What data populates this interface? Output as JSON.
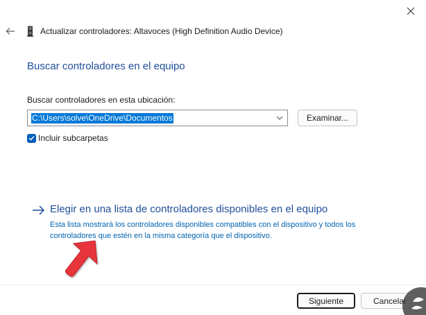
{
  "window": {
    "title": "Actualizar controladores: Altavoces (High Definition Audio Device)"
  },
  "page": {
    "heading": "Buscar controladores en el equipo",
    "location_label": "Buscar controladores en esta ubicación:",
    "path_value": "C:\\Users\\solve\\OneDrive\\Documentos",
    "browse_label": "Examinar...",
    "include_subfolders_label": "Incluir subcarpetas",
    "include_subfolders_checked": true
  },
  "pick_option": {
    "title": "Elegir en una lista de controladores disponibles en el equipo",
    "description": "Esta lista mostrará los controladores disponibles compatibles con el dispositivo y todos los controladores que estén en la misma categoría que el dispositivo."
  },
  "footer": {
    "next_label": "Siguiente",
    "cancel_label": "Cancelar"
  },
  "icons": {
    "close": "close-icon",
    "back": "back-arrow-icon",
    "device": "speaker-device-icon",
    "dropdown": "chevron-down-icon",
    "check": "checkmark-icon",
    "link_arrow": "right-arrow-icon",
    "pointer": "red-pointer-arrow-icon",
    "watermark": "site-logo-icon"
  },
  "colors": {
    "heading_blue": "#1f4e9a",
    "link_text_blue": "#0063b1",
    "selection_blue": "#0078d7",
    "checkbox_blue": "#005fb8",
    "pointer_red": "#e8343a"
  }
}
